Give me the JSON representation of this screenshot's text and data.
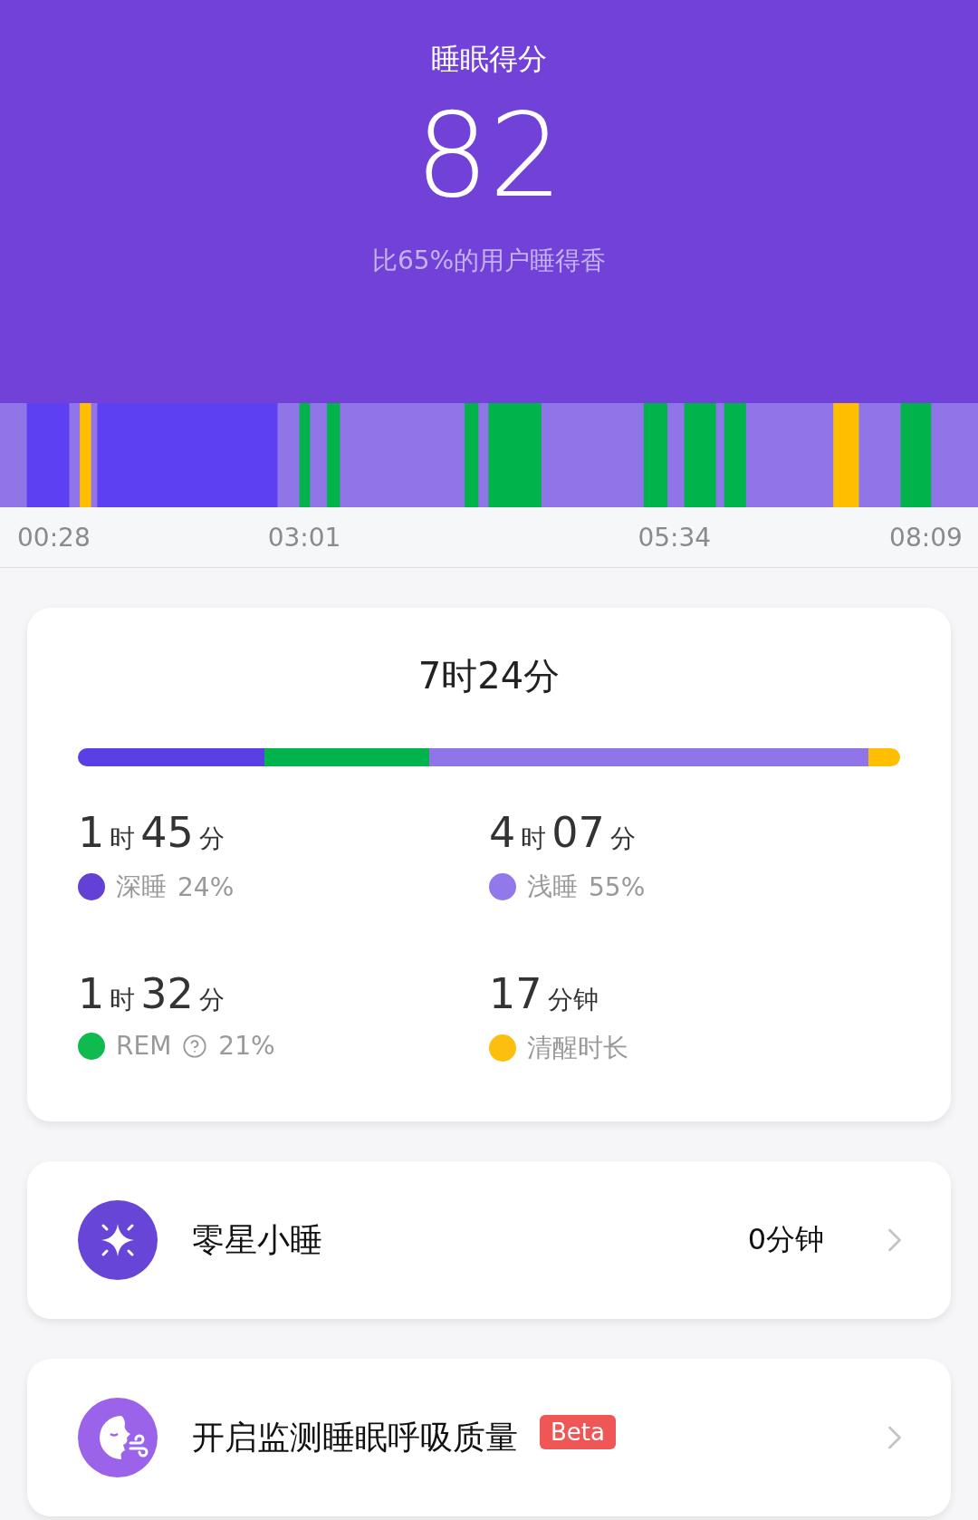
{
  "header": {
    "title": "睡眠得分",
    "score": "82",
    "comparison": "比65%的用户睡得香"
  },
  "timeline": {
    "times": [
      "00:28",
      "03:01",
      "05:34",
      "08:09"
    ]
  },
  "summary": {
    "total": "7时24分",
    "stages": [
      {
        "amount": [
          {
            "text": "1",
            "kind": "number"
          },
          {
            "text": "时",
            "kind": "unit"
          },
          {
            "text": "45",
            "kind": "number"
          },
          {
            "text": "分",
            "kind": "unit"
          }
        ],
        "label": "深睡",
        "help": false,
        "percent": "24%",
        "color": "#6340d6"
      },
      {
        "amount": [
          {
            "text": "4",
            "kind": "number"
          },
          {
            "text": "时",
            "kind": "unit"
          },
          {
            "text": "07",
            "kind": "number"
          },
          {
            "text": "分",
            "kind": "unit"
          }
        ],
        "label": "浅睡",
        "help": false,
        "percent": "55%",
        "color": "#9378ec"
      },
      {
        "amount": [
          {
            "text": "1",
            "kind": "number"
          },
          {
            "text": "时",
            "kind": "unit"
          },
          {
            "text": "32",
            "kind": "number"
          },
          {
            "text": "分",
            "kind": "unit"
          }
        ],
        "label": "REM",
        "help": true,
        "percent": "21%",
        "color": "#0fbb4e"
      },
      {
        "amount": [
          {
            "text": "17",
            "kind": "number"
          },
          {
            "text": "分钟",
            "kind": "unit"
          }
        ],
        "label": "清醒时长",
        "help": false,
        "color": "#fcbf10"
      }
    ]
  },
  "rows": [
    {
      "kind": "nap",
      "title": "零星小睡",
      "value": "0分钟"
    },
    {
      "kind": "breathing",
      "title": "开启监测睡眠呼吸质量",
      "badge": "Beta"
    }
  ]
}
